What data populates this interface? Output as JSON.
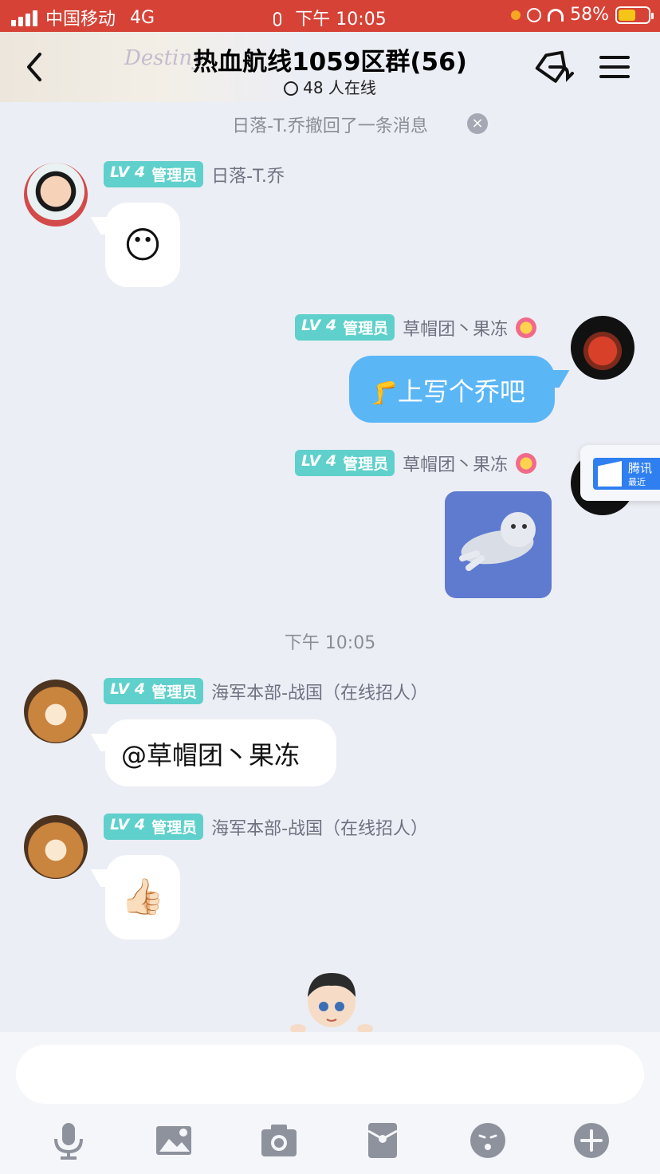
{
  "status_bar": {
    "carrier": "中国移动",
    "network": "4G",
    "time": "下午 10:05",
    "battery": "58%",
    "battery_level": 0.58
  },
  "header": {
    "back_icon": "chevron-left-icon",
    "logo_text": "Destiny",
    "title": "热血航线1059区群(56)",
    "online_count": "48 人在线",
    "share_icon": "tag-share-icon",
    "menu_icon": "hamburger-menu-icon"
  },
  "notice": {
    "text": "日落-T.乔撤回了一条消息",
    "close_glyph": "×"
  },
  "messages": [
    {
      "level": "LV",
      "level_num": "4",
      "role": "管理员",
      "sender": "日落-T.乔",
      "content_type": "emoji",
      "emoji": "😶"
    },
    {
      "level": "LV",
      "level_num": "4",
      "role": "管理员",
      "sender": "草帽团丶果冻",
      "content_type": "text",
      "text": "上写个乔吧",
      "emoji_prefix": "🦵"
    },
    {
      "level": "LV",
      "level_num": "4",
      "role": "管理员",
      "sender": "草帽团丶果冻",
      "content_type": "sticker"
    },
    {
      "level": "LV",
      "level_num": "4",
      "role": "管理员",
      "sender": "海军本部-战国（在线招人）",
      "content_type": "text",
      "text": "@草帽团丶果冻"
    },
    {
      "level": "LV",
      "level_num": "4",
      "role": "管理员",
      "sender": "海军本部-战国（在线招人）",
      "content_type": "emoji",
      "emoji": "👍🏻"
    }
  ],
  "time_separator": "下午 10:05",
  "float_card": {
    "line1": "腾讯",
    "line2": "最近"
  },
  "composer": {
    "placeholder": "",
    "tools": [
      "microphone-icon",
      "image-icon",
      "camera-icon",
      "red-packet-icon",
      "emoji-face-icon",
      "plus-icon"
    ]
  },
  "colors": {
    "status_bar": "#d64236",
    "badge": "#5fd0cb",
    "outgoing_bubble": "#5bb6f6",
    "background": "#eceef5"
  }
}
